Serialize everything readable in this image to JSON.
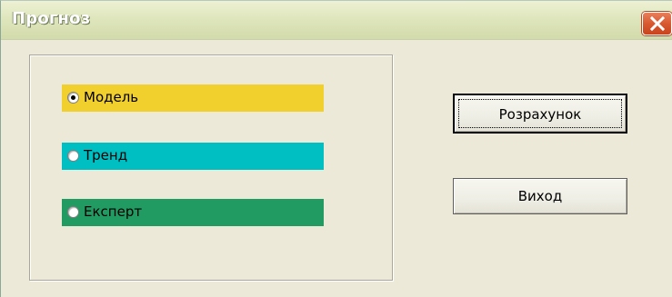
{
  "window": {
    "title": "Прогноз"
  },
  "titlebar": {
    "close_icon": "close-icon"
  },
  "options": [
    {
      "label": "Модель",
      "selected": true,
      "color": "#f1d02e"
    },
    {
      "label": "Тренд",
      "selected": false,
      "color": "#00bfc3"
    },
    {
      "label": "Експерт",
      "selected": false,
      "color": "#229b63"
    }
  ],
  "buttons": {
    "calculate_label": "Розрахунок",
    "exit_label": "Виход"
  },
  "colors": {
    "window_bg": "#ece9d8",
    "close_button": "#d9592f"
  }
}
